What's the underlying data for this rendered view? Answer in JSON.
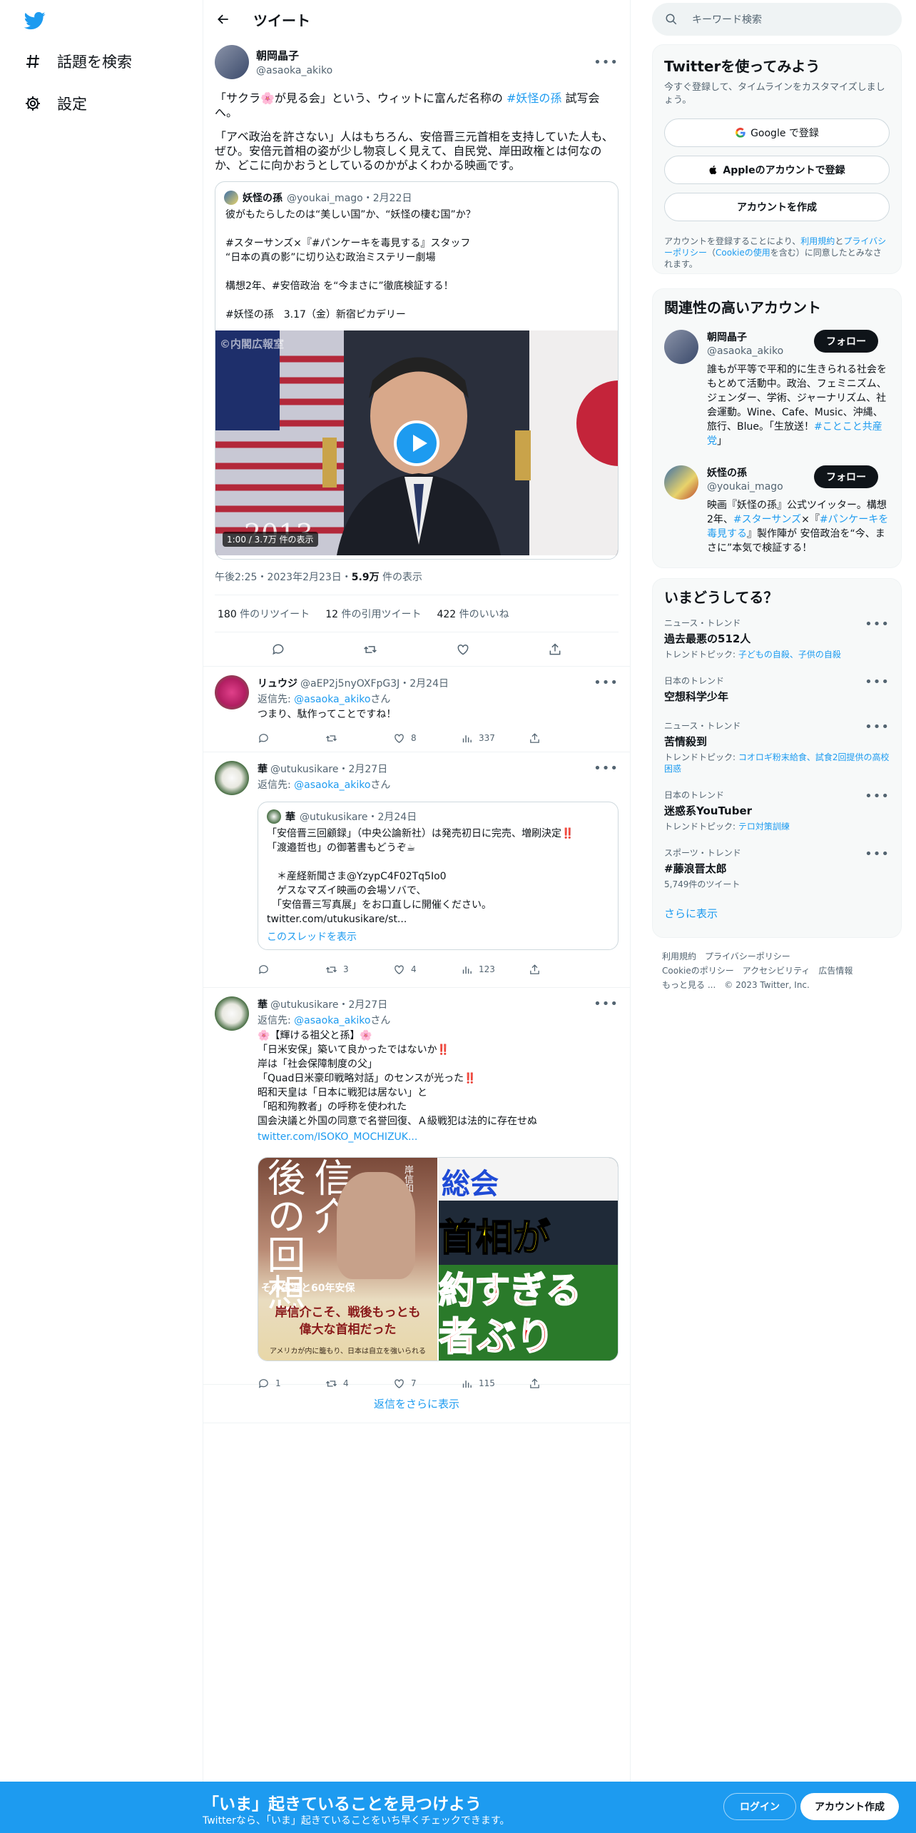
{
  "nav": {
    "explore_label": "話題を検索",
    "settings_label": "設定"
  },
  "header": {
    "title": "ツイート"
  },
  "focal": {
    "name": "朝岡晶子",
    "handle": "@asaoka_akiko",
    "para1_a": "「サクラ🌸が見る会」という、ウィットに富んだ名称の ",
    "para1_link": "#妖怪の孫",
    "para1_b": " 試写会へ。",
    "para2": "「アベ政治を許さない」人はもちろん、安倍晋三元首相を支持していた人も、ぜひ。安倍元首相の姿が少し物哀しく見えて、自民党、岸田政権とは何なのか、どこに向かおうとしているのかがよくわかる映画です。",
    "quote": {
      "name": "妖怪の孫",
      "handle_date": "@youkai_mago・2月22日",
      "text": "彼がもたらしたのは“美しい国”か、“妖怪の棲む国”か？\n\n#スターサンズ×『#パンケーキを毒見する』スタッフ\n“日本の真の影”に切り込む政治ミステリー劇場\n\n構想2年、#安倍政治 を“今まさに”徹底検証する！\n\n#妖怪の孫　3.17（金）新宿ピカデリー",
      "video_watermark": "©内閣広報室",
      "video_year": "2013",
      "video_duration": "1:00 / 3.7万 件の表示"
    },
    "time_date": "午後2:25・2023年2月23日・",
    "views_count": "5.9万",
    "views_label": " 件の表示",
    "retweets": "180",
    "retweets_label": " 件のリツイート",
    "quotes": "12",
    "quotes_label": " 件の引用ツイート",
    "likes": "422",
    "likes_label": " 件のいいね"
  },
  "replies": [
    {
      "name": "リュウジ",
      "handle_date": "@aEP2j5nyOXFpG3J・2月24日",
      "to_prefix": "返信先: ",
      "to_handle": "@asaoka_akiko",
      "to_suffix": "さん",
      "text": "つまり、駄作ってことですね！",
      "reply_count": "",
      "retweet_count": "",
      "like_count": "8",
      "view_count": "337"
    },
    {
      "name": "華",
      "handle_date": "@utukusikare・2月27日",
      "to_prefix": "返信先: ",
      "to_handle": "@asaoka_akiko",
      "to_suffix": "さん",
      "quote_name": "華",
      "quote_handle_date": "@utukusikare・2月24日",
      "quote_text": "「安倍晋三回顧録」（中央公論新社）は発売初日に完売、増刷決定‼️\n「渡邉哲也」の御著書もどうぞ☕\n\n　＊産経新聞さま@YzypC4F02Tq5Io0\n　ゲスなマズイ映画の会場ソバで、\n　「安倍晋三写真展」をお口直しに開催ください。\ntwitter.com/utukusikare/st...",
      "quote_thread": "このスレッドを表示",
      "reply_count": "",
      "retweet_count": "3",
      "like_count": "4",
      "view_count": "123"
    },
    {
      "name": "華",
      "handle_date": "@utukusikare・2月27日",
      "to_prefix": "返信先: ",
      "to_handle": "@asaoka_akiko",
      "to_suffix": "さん",
      "text": "🌸【輝ける祖父と孫】🌸\n「日米安保」築いて良かったではないか‼️\n岸は「社会保障制度の父」\n「Quad日米豪印戦略対話」のセンスが光った‼️\n昭和天皇は「日本に戦犯は居ない」と\n「昭和殉教者」の呼称を使われた\n国会決議と外国の同意で名誉回復、Ａ級戦犯は法的に存在せぬ",
      "link": "twitter.com/ISOKO_MOCHIZUK...",
      "img1_title1": "後の回想",
      "img1_title2": "信介",
      "img1_caption": "その生涯と60年安保",
      "img1_band": "岸信介こそ、戦後もっとも\n偉大な首相だった",
      "img1_note": "アメリカが内に籠もり、日本は自立を強いられる",
      "img1_side": "岸信和",
      "img2_top": "総会",
      "img2_mid": "首相が",
      "img2_red1": "約すぎる",
      "img2_red2": "者ぶり",
      "reply_count": "1",
      "retweet_count": "4",
      "like_count": "7",
      "view_count": "115"
    }
  ],
  "show_more_replies": "返信をさらに表示",
  "search": {
    "placeholder": "キーワード検索"
  },
  "signup": {
    "title": "Twitterを使ってみよう",
    "subtitle": "今すぐ登録して、タイムラインをカスタマイズしましょう。",
    "google": "Google で登録",
    "apple": "Appleのアカウントで登録",
    "create": "アカウントを作成",
    "legal_a": "アカウントを登録することにより、",
    "legal_terms": "利用規約",
    "legal_b": "と",
    "legal_privacy": "プライバシーポリシー",
    "legal_c": "（",
    "legal_cookie": "Cookieの使用",
    "legal_d": "を含む）に同意したとみなされます。"
  },
  "related": {
    "title": "関連性の高いアカウント",
    "follow_label": "フォロー",
    "accounts": [
      {
        "name": "朝岡晶子",
        "handle": "@asaoka_akiko",
        "bio": "誰もが平等で平和的に生きられる社会をもとめて活動中。政治、フェミニズム、ジェンダー、学術、ジャーナリズム、社会運動。Wine、Cafe、Music、沖縄、旅行、Blue。「生放送！",
        "bio_link": "#ことこと共産党",
        "bio_end": "」"
      },
      {
        "name": "妖怪の孫",
        "handle": "@youkai_mago",
        "bio_a": "映画『妖怪の孫』公式ツイッター。構想2年、",
        "bio_link1": "#スターサンズ",
        "bio_b": "×『",
        "bio_link2": "#パンケーキを毒見する",
        "bio_c": "』製作陣が 安倍政治を“今、まさに”本気で検証する！"
      }
    ]
  },
  "trends": {
    "title": "いまどうしてる？",
    "items": [
      {
        "context": "ニュース・トレンド",
        "topic": "過去最悪の512人",
        "sub_prefix": "トレンドトピック: ",
        "sub_link": "子どもの自殺、子供の自殺"
      },
      {
        "context": "日本のトレンド",
        "topic": "空想科学少年",
        "sub_prefix": "",
        "sub_link": ""
      },
      {
        "context": "ニュース・トレンド",
        "topic": "苦情殺到",
        "sub_prefix": "トレンドトピック: ",
        "sub_link": "コオロギ粉末給食、試食2回提供の高校困惑"
      },
      {
        "context": "日本のトレンド",
        "topic": "迷惑系YouTuber",
        "sub_prefix": "トレンドトピック: ",
        "sub_link": "テロ対策訓練"
      },
      {
        "context": "スポーツ・トレンド",
        "topic": "#藤浪晋太郎",
        "sub_prefix": "5,749件のツイート",
        "sub_link": ""
      }
    ],
    "show_more": "さらに表示"
  },
  "footer": {
    "terms": "利用規約",
    "privacy": "プライバシーポリシー",
    "cookie": "Cookieのポリシー",
    "accessibility": "アクセシビリティ",
    "ads": "広告情報",
    "more": "もっと見る ...",
    "copyright": "© 2023 Twitter, Inc."
  },
  "bottombar": {
    "headline": "「いま」起きていることを見つけよう",
    "subline": "Twitterなら、「いま」起きていることをいち早くチェックできます。",
    "login": "ログイン",
    "signup": "アカウント作成"
  },
  "colors": {
    "accent": "#1d9bf0",
    "text": "#0f1419",
    "muted": "#536471"
  }
}
